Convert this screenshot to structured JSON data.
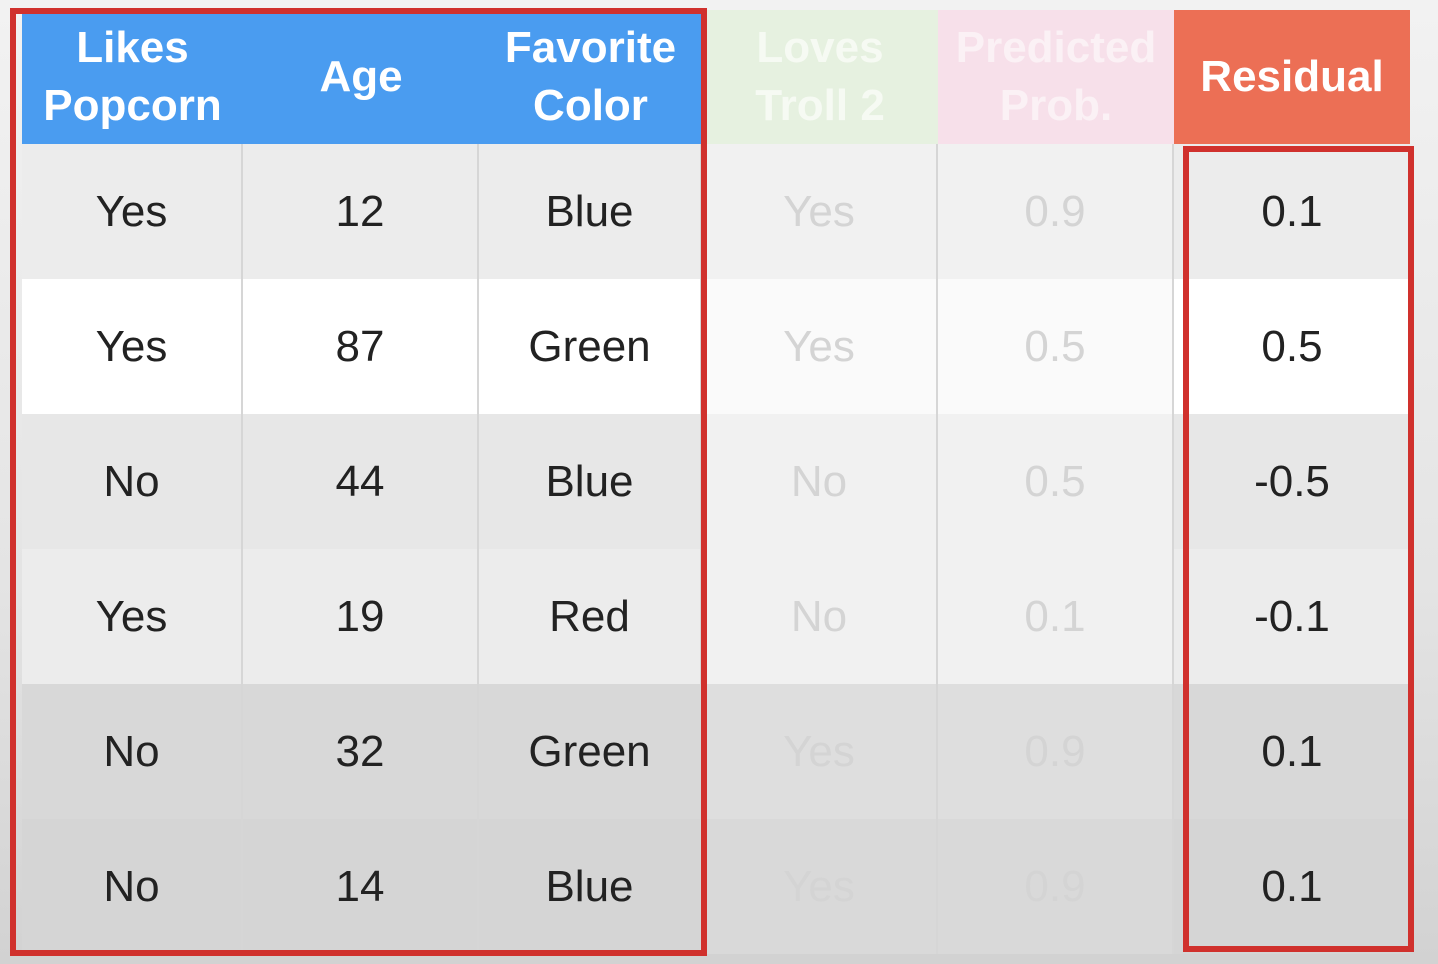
{
  "table": {
    "headers": [
      {
        "label": "Likes\nPopcorn",
        "style": "blue"
      },
      {
        "label": "Age",
        "style": "blue"
      },
      {
        "label": "Favorite\nColor",
        "style": "blue"
      },
      {
        "label": "Loves\nTroll 2",
        "style": "green"
      },
      {
        "label": "Predicted\nProb.",
        "style": "pink"
      },
      {
        "label": "Residual",
        "style": "red"
      }
    ],
    "rows": [
      [
        "Yes",
        "12",
        "Blue",
        "Yes",
        "0.9",
        "0.1"
      ],
      [
        "Yes",
        "87",
        "Green",
        "Yes",
        "0.5",
        "0.5"
      ],
      [
        "No",
        "44",
        "Blue",
        "No",
        "0.5",
        "-0.5"
      ],
      [
        "Yes",
        "19",
        "Red",
        "No",
        "0.1",
        "-0.1"
      ],
      [
        "No",
        "32",
        "Green",
        "Yes",
        "0.9",
        "0.1"
      ],
      [
        "No",
        "14",
        "Blue",
        "Yes",
        "0.9",
        "0.1"
      ]
    ]
  },
  "colors": {
    "header_blue": "#4a9cf0",
    "header_green": "#e6f1e0",
    "header_pink": "#f7e0ea",
    "header_red": "#ec6f55",
    "highlight_frame": "#d0312d"
  }
}
